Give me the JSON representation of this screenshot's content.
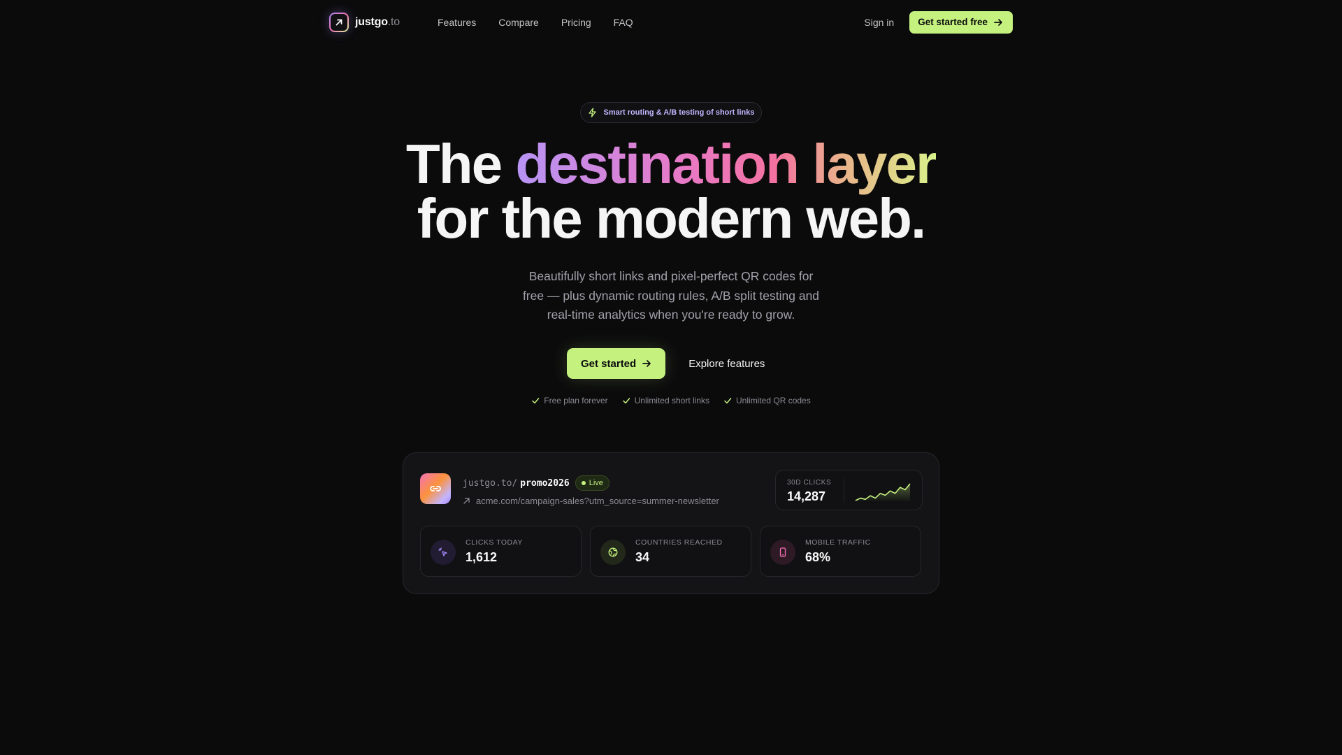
{
  "brand": {
    "name": "justgo",
    "tld": ".to"
  },
  "nav": {
    "links": [
      "Features",
      "Compare",
      "Pricing",
      "FAQ"
    ],
    "sign_in": "Sign in",
    "cta": "Get started free"
  },
  "hero": {
    "pill": "Smart routing & A/B testing of short links",
    "headline_start": "The ",
    "headline_gradient": "destination layer",
    "headline_line2": "for the modern web.",
    "subtitle": "Beautifully short links and pixel-perfect QR codes for free — plus dynamic routing rules, A/B split testing and real-time analytics when you're ready to grow.",
    "primary_cta": "Get started",
    "secondary_cta": "Explore features",
    "checks": [
      "Free plan forever",
      "Unlimited short links",
      "Unlimited QR codes"
    ]
  },
  "card": {
    "host": "justgo.to/",
    "slug": "promo2026",
    "status": "Live",
    "destination": "acme.com/campaign-sales?utm_source=summer-newsletter",
    "clicks_30d_label": "30D CLICKS",
    "clicks_30d": "14,287",
    "sparkline": [
      2,
      3,
      2.5,
      4,
      3,
      5,
      4.2,
      6,
      5,
      7.5,
      6.5,
      9
    ],
    "stats": [
      {
        "label": "CLICKS TODAY",
        "value": "1,612",
        "icon": "cursor-click-icon",
        "color": "#a78bfa"
      },
      {
        "label": "COUNTRIES REACHED",
        "value": "34",
        "icon": "globe-icon",
        "color": "#c5f27f"
      },
      {
        "label": "MOBILE TRAFFIC",
        "value": "68%",
        "icon": "phone-icon",
        "color": "#f472b6"
      }
    ]
  },
  "colors": {
    "accent": "#c5f27f",
    "background": "#0b0b0c",
    "violet": "#a78bfa",
    "pink": "#f472b6"
  }
}
